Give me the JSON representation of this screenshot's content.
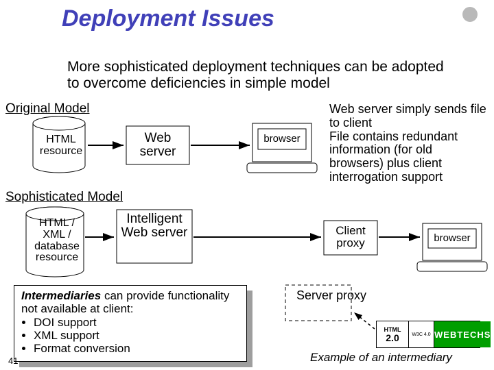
{
  "title": "Deployment Issues",
  "intro": "More sophisticated deployment techniques can be adopted to overcome deficiencies in simple model",
  "headers": {
    "original": "Original Model",
    "sophisticated": "Sophisticated Model"
  },
  "original": {
    "resource": "HTML resource",
    "server": "Web server",
    "client": "browser",
    "description": "Web server simply sends file to client\nFile contains redundant information (for old browsers) plus client interrogation support"
  },
  "sophisticated": {
    "resource": "HTML / XML  / database resource",
    "server": "Intelligent Web server",
    "client_proxy": "Client proxy",
    "server_proxy": "Server proxy",
    "client": "browser"
  },
  "intermediary_note": {
    "lead": "Intermediaries",
    "body": " can provide functionality not available at client:",
    "bullets": [
      "DOI support",
      "XML support",
      "Format conversion"
    ]
  },
  "example_caption": "Example of an intermediary",
  "badges": {
    "html_top": "HTML",
    "html_ver": "2.0",
    "w3c": "W3C 4.0",
    "webtechs": "WEBTECHS"
  },
  "page_number": "41"
}
